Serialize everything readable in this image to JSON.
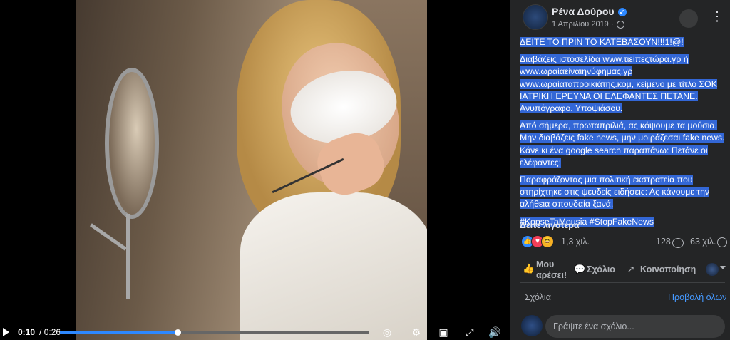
{
  "video": {
    "current_time": "0:10",
    "duration": "/ 0:26",
    "progress_fraction": 0.38,
    "icons": [
      "play-icon",
      "settings-icon",
      "pip-icon",
      "fullscreen-icon",
      "volume-icon",
      "caption-icon"
    ]
  },
  "post": {
    "author": "Ρένα Δούρου",
    "date": "1 Απριλίου 2019 ·",
    "paragraphs": [
      "ΔΕΙΤΕ ΤΟ ΠΡΙΝ ΤΟ ΚΑΤΕΒΑΣΟΥΝ!!!1!@!",
      "Διαβάζεις ιστοσελίδα www.τιείπεςτώρα.γρ ή www.ωραίαείναιηνύφημας.γρ www.ωραίαταπροικιάτης.κομ, κείμενο με τίτλο ΣΟΚ ΙΑΤΡΙΚΗ ΕΡΕΥΝΑ ΟΙ ΕΛΕΦΑΝΤΕΣ ΠΕΤΑΝΕ. Ανυπόγραφο. Υποψιάσου.",
      "Από σήμερα, πρωταπριλιά, ας κόψουμε τα μούσια. Μην διαβάζεις fake news, μην μοιράζεσαι fake news. Κάνε κι ένα google search παραπάνω: Πετάνε οι ελέφαντες;",
      "Παραφράζοντας μια πολιτική εκστρατεία που στηρίχτηκε στις ψευδείς ειδήσεις: Ας κάνουμε την αλήθεια σπουδαία ξανά.",
      "#KopseTaMousia #StopFakeNews"
    ],
    "see_less": "Δείτε λιγότερα"
  },
  "stats": {
    "reactions_count": "1,3 χιλ.",
    "comments_count": "128",
    "shares_count": "63 χιλ."
  },
  "actions": {
    "like": "Μου αρέσει!",
    "comment": "Σχόλιο",
    "share": "Κοινοποίηση"
  },
  "comments": {
    "label": "Σχόλια",
    "view_all": "Προβολή όλων",
    "placeholder": "Γράψτε ένα σχόλιο..."
  },
  "colors": {
    "panel_bg": "#242526",
    "highlight": "#3367d6",
    "accent": "#2d88ff"
  }
}
